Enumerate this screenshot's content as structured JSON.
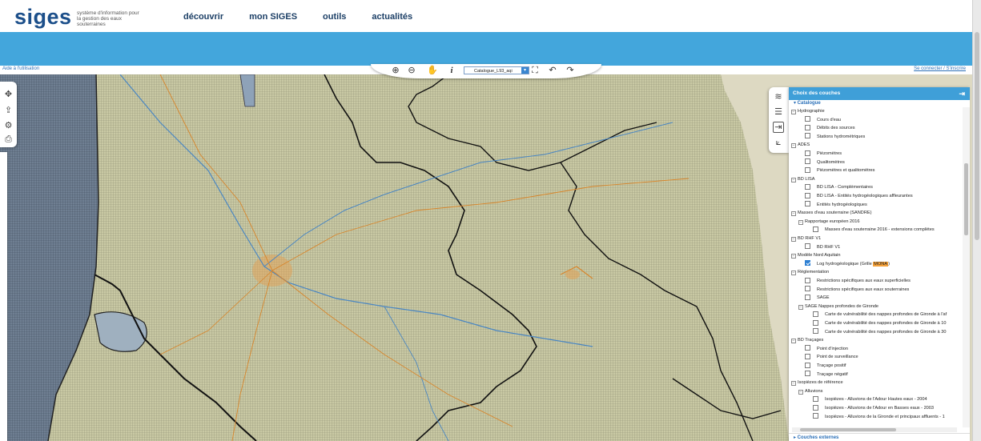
{
  "header": {
    "logo": "siges",
    "tagline": "système d'information pour la gestion des eaux souterraines",
    "nav": [
      "découvrir",
      "mon SIGES",
      "outils",
      "actualités"
    ]
  },
  "topbar": {
    "help": "Aide à l'utilisation",
    "login": "Se connecter / S'inscrire"
  },
  "toolbar": {
    "catalog_select": "Catalogue_L93_aqi",
    "icons": [
      "zoom-in-icon",
      "zoom-out-icon",
      "pan-hand-icon",
      "info-icon",
      "full-extent-icon",
      "undo-icon",
      "redo-icon"
    ]
  },
  "left_tools": [
    "move-icon",
    "export-icon",
    "settings-icon",
    "print-icon"
  ],
  "right_tools": [
    "layers-icon",
    "legend-icon",
    "import-icon",
    "measure-icon"
  ],
  "panel": {
    "title": "Choix des couches",
    "catalog": "▾ Catalogue",
    "external": "▸ Couches externes",
    "tree": [
      {
        "level": 0,
        "kind": "group",
        "label": "Hydrographie"
      },
      {
        "level": 1,
        "kind": "layer",
        "checked": false,
        "label": "Cours d'eau"
      },
      {
        "level": 1,
        "kind": "layer",
        "checked": false,
        "label": "Débits des sources"
      },
      {
        "level": 1,
        "kind": "layer",
        "checked": false,
        "label": "Stations hydrométriques"
      },
      {
        "level": 0,
        "kind": "group",
        "label": "ADES"
      },
      {
        "level": 1,
        "kind": "layer",
        "checked": false,
        "label": "Piézomètres"
      },
      {
        "level": 1,
        "kind": "layer",
        "checked": false,
        "label": "Qualitomètres"
      },
      {
        "level": 1,
        "kind": "layer",
        "checked": false,
        "label": "Piézomètres et qualitomètres"
      },
      {
        "level": 0,
        "kind": "group",
        "label": "BD LISA"
      },
      {
        "level": 1,
        "kind": "layer",
        "checked": false,
        "label": "BD LISA - Complémentaires"
      },
      {
        "level": 1,
        "kind": "layer",
        "checked": false,
        "label": "BD LISA - Entités hydrogéologiques affleurantes"
      },
      {
        "level": 1,
        "kind": "layer",
        "checked": false,
        "label": "Entités hydrogéologiques"
      },
      {
        "level": 0,
        "kind": "group",
        "label": "Masses d'eau souterraine (SANDRE)"
      },
      {
        "level": 1,
        "kind": "group",
        "label": "Rapportage européen 2016"
      },
      {
        "level": 2,
        "kind": "layer",
        "checked": false,
        "label": "Masses d'eau souterraine 2016 - extensions complètes"
      },
      {
        "level": 0,
        "kind": "group",
        "label": "BD RHF V1"
      },
      {
        "level": 1,
        "kind": "layer",
        "checked": false,
        "label": "BD RHF V1"
      },
      {
        "level": 0,
        "kind": "group",
        "label": "Modèle Nord Aquitain"
      },
      {
        "level": 1,
        "kind": "layer",
        "checked": true,
        "label": "Log hydrogéologique (Grille ",
        "highlight": "MONA",
        "suffix": ")"
      },
      {
        "level": 0,
        "kind": "group",
        "label": "Réglementation"
      },
      {
        "level": 1,
        "kind": "layer",
        "checked": false,
        "label": "Restrictions spécifiques aux eaux superficielles"
      },
      {
        "level": 1,
        "kind": "layer",
        "checked": false,
        "label": "Restrictions spécifiques aux eaux souterraines"
      },
      {
        "level": 1,
        "kind": "layer",
        "checked": false,
        "label": "SAGE"
      },
      {
        "level": 1,
        "kind": "group",
        "label": "SAGE Nappes profondes de Gironde"
      },
      {
        "level": 2,
        "kind": "layer",
        "checked": false,
        "label": "Carte de vulnérabilité des nappes profondes de Gironde à l'af"
      },
      {
        "level": 2,
        "kind": "layer",
        "checked": false,
        "label": "Carte de vulnérabilité des nappes profondes de Gironde à 10"
      },
      {
        "level": 2,
        "kind": "layer",
        "checked": false,
        "label": "Carte de vulnérabilité des nappes profondes de Gironde à 30"
      },
      {
        "level": 0,
        "kind": "group",
        "label": "BD Traçages"
      },
      {
        "level": 1,
        "kind": "layer",
        "checked": false,
        "label": "Point d'injection"
      },
      {
        "level": 1,
        "kind": "layer",
        "checked": false,
        "label": "Point de surveillance"
      },
      {
        "level": 1,
        "kind": "layer",
        "checked": false,
        "label": "Traçage positif"
      },
      {
        "level": 1,
        "kind": "layer",
        "checked": false,
        "label": "Traçage négatif"
      },
      {
        "level": 0,
        "kind": "group",
        "label": "Isopièzes de référence"
      },
      {
        "level": 1,
        "kind": "group",
        "label": "Alluvions"
      },
      {
        "level": 2,
        "kind": "layer",
        "checked": false,
        "label": "Isopièzes - Alluvions de l'Adour Hautes eaux - 2004"
      },
      {
        "level": 2,
        "kind": "layer",
        "checked": false,
        "label": "Isopièzes - Alluvions de l'Adour en Basses eaux - 2003"
      },
      {
        "level": 2,
        "kind": "layer",
        "checked": false,
        "label": "Isopièzes - Alluvions de la Gironde et principaux affluents - 1"
      }
    ]
  },
  "colors": {
    "brand": "#1c4f8a",
    "banner": "#43a6dc",
    "panel_header": "#3f9fd8",
    "highlight": "#f4a13a",
    "sea": "#6f7f92",
    "land": "#c9c9a4"
  }
}
